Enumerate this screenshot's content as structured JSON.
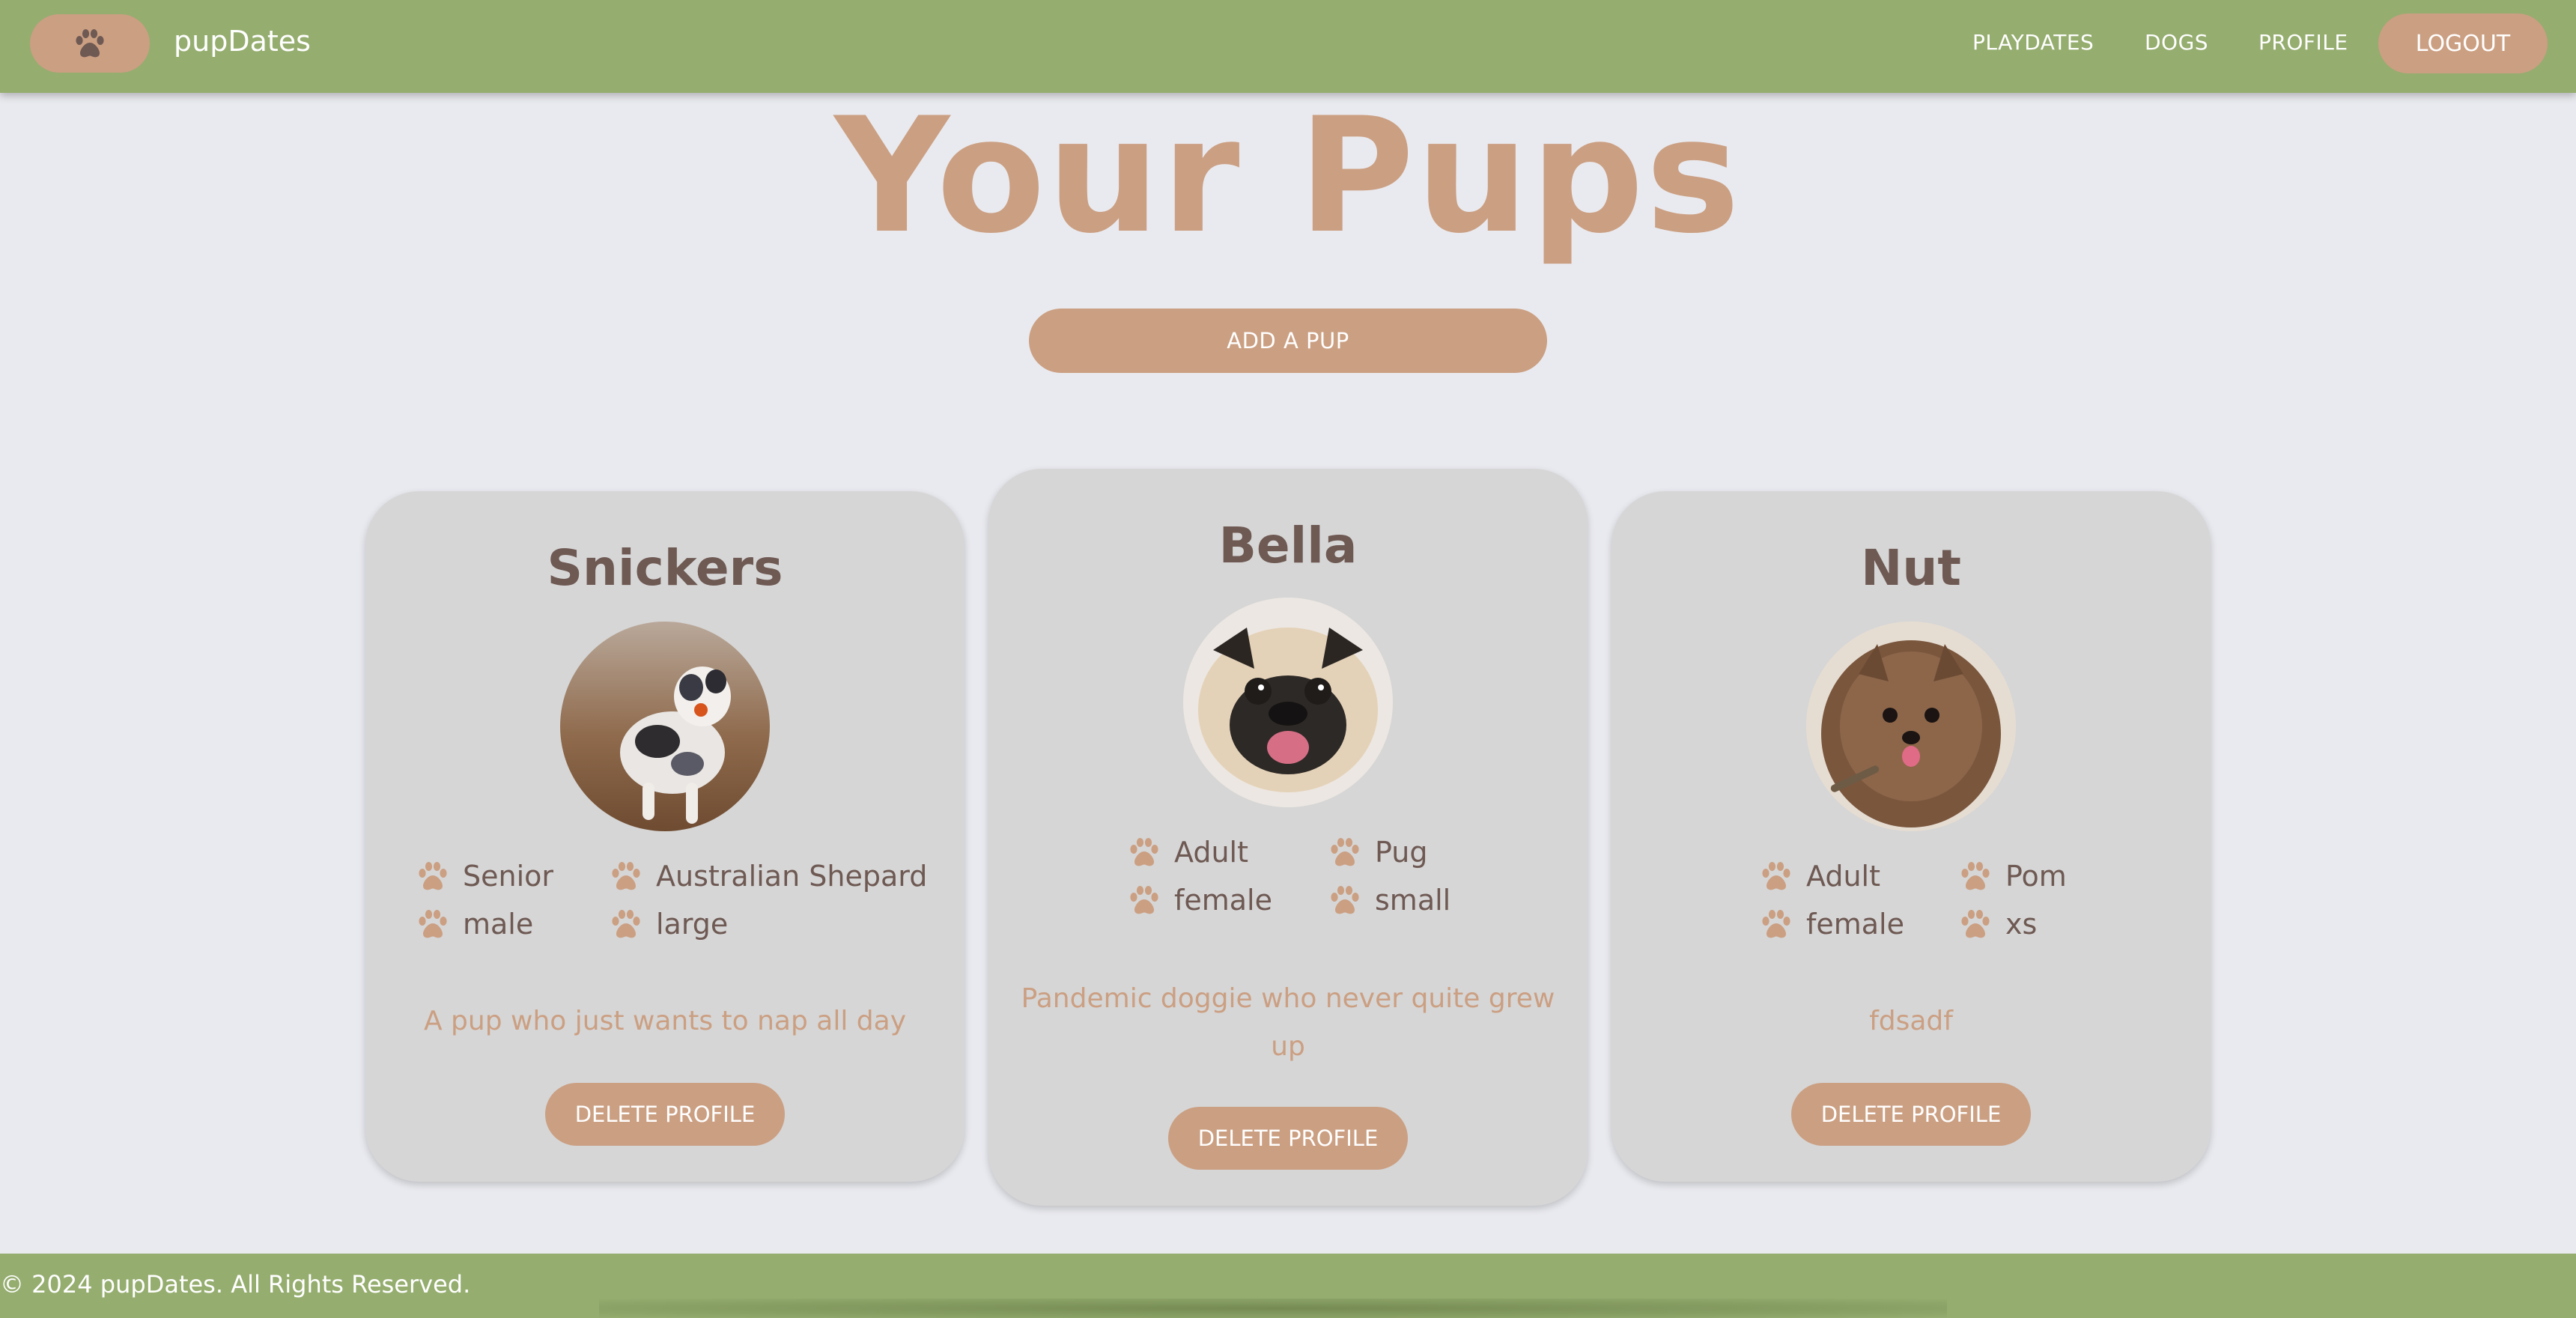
{
  "nav": {
    "brand": "pupDates",
    "links": [
      "PLAYDATES",
      "DOGS",
      "PROFILE"
    ],
    "logout": "LOGOUT",
    "logo_icon": "paw-icon"
  },
  "page": {
    "title": "Your Pups",
    "add_button": "ADD A PUP"
  },
  "cards": [
    {
      "name": "Snickers",
      "photo": "australian-shepherd-photo",
      "attrs": [
        "Senior",
        "Australian Shepard",
        "male",
        "large"
      ],
      "description": "A pup who just wants to nap all day",
      "delete_button": "DELETE PROFILE"
    },
    {
      "name": "Bella",
      "photo": "pug-photo",
      "attrs": [
        "Adult",
        "Pug",
        "female",
        "small"
      ],
      "description": "Pandemic doggie who never quite grew up",
      "delete_button": "DELETE PROFILE"
    },
    {
      "name": "Nut",
      "photo": "pomeranian-photo",
      "attrs": [
        "Adult",
        "Pom",
        "female",
        "xs"
      ],
      "description": "fdsadf",
      "delete_button": "DELETE PROFILE"
    }
  ],
  "footer": {
    "text": "© 2024 pupDates. All Rights Reserved."
  },
  "colors": {
    "nav_green": "#95ad6f",
    "accent_tan": "#cb9f82",
    "card_gray": "#d6d6d6",
    "text_brown": "#6e5953",
    "background": "#e9eaef"
  }
}
